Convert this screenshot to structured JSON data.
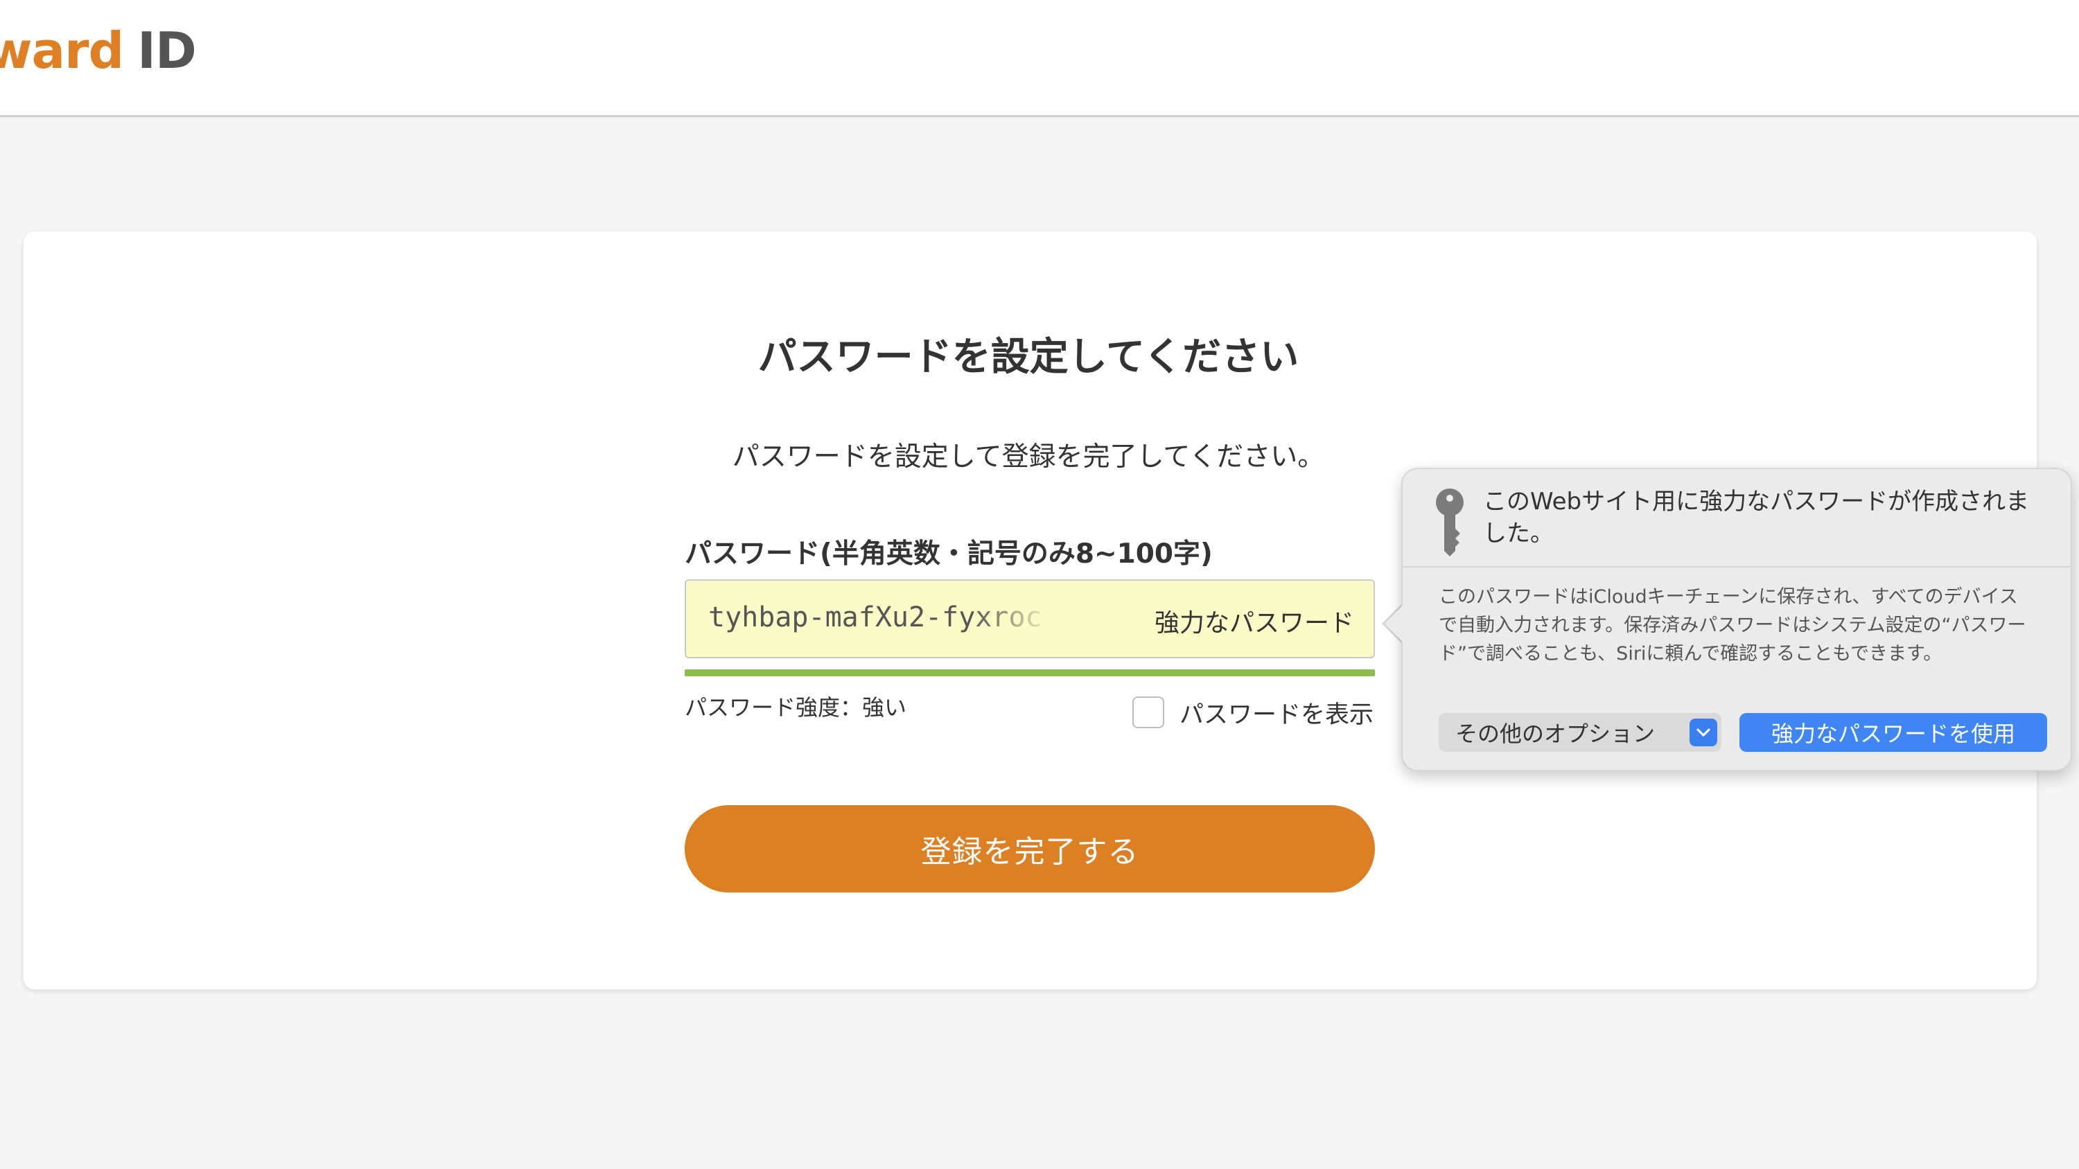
{
  "header": {
    "logo_word": "ward",
    "logo_id": "ID"
  },
  "form": {
    "title": "パスワードを設定してください",
    "subtitle": "パスワードを設定して登録を完了してください。",
    "password_label": "パスワード(半角英数・記号のみ8~100字)",
    "password_value": "tyhbap-mafXu2-fyxroc",
    "strong_password_tag": "強力なパスワード",
    "strength_label": "パスワード強度：強い",
    "strength_level": 1.0,
    "show_password_label": "パスワードを表示",
    "show_password_checked": false,
    "submit_label": "登録を完了する"
  },
  "popover": {
    "title": "このWebサイト用に強力なパスワードが作成されました。",
    "description": "このパスワードはiCloudキーチェーンに保存され、すべてのデバイスで自動入力されます。保存済みパスワードはシステム設定の“パスワード”で調べることも、Siriに頼んで確認することもできます。",
    "other_options_label": "その他のオプション",
    "use_strong_password_label": "強力なパスワードを使用",
    "icon": "key-icon"
  },
  "colors": {
    "brand_orange": "#db7f22",
    "autofill_yellow": "#fbfbc7",
    "strength_green": "#8dbd4c",
    "system_blue": "#3f86f4"
  }
}
